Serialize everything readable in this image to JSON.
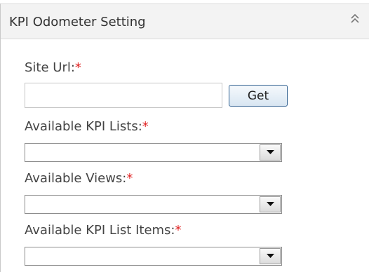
{
  "header": {
    "title": "KPI Odometer Setting",
    "collapse_icon": "double-chevron-up-icon"
  },
  "form": {
    "required_marker": "*",
    "site_url": {
      "label": "Site Url:",
      "value": "",
      "button_label": "Get"
    },
    "kpi_lists": {
      "label": "Available KPI Lists:",
      "selected": ""
    },
    "views": {
      "label": "Available Views:",
      "selected": ""
    },
    "kpi_list_items": {
      "label": "Available KPI List Items:",
      "selected": ""
    }
  },
  "colors": {
    "required": "#e02020",
    "header_bg": "#f3f3f3",
    "button_border": "#2f5f8f"
  }
}
